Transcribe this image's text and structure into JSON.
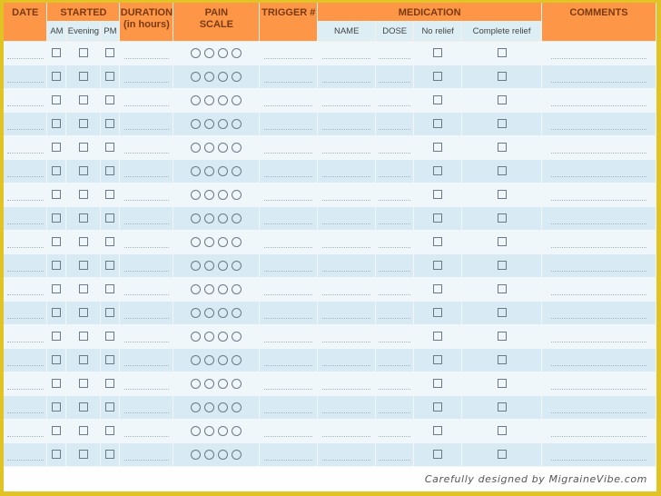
{
  "header": {
    "date": "DATE",
    "started": "STARTED",
    "started_sub": [
      "AM",
      "Evening",
      "PM"
    ],
    "duration_line1": "DURATION",
    "duration_line2": "(in hours)",
    "pain_line1": "PAIN",
    "pain_line2": "SCALE",
    "trigger": "TRIGGER #",
    "medication": "MEDICATION",
    "medication_sub": [
      "NAME",
      "DOSE",
      "No relief",
      "Complete relief"
    ],
    "comments": "COMMENTS"
  },
  "rows": {
    "count": 18,
    "pain_scale_options": 4
  },
  "footer": {
    "credit": "Carefully designed by MigraineVibe.com"
  },
  "colors": {
    "header_orange": "#fe9648",
    "subheader_blue": "#ddeef5",
    "row_light": "#f0f7fb",
    "row_dark": "#d8eaf3",
    "frame_yellow": "#e2c324"
  }
}
